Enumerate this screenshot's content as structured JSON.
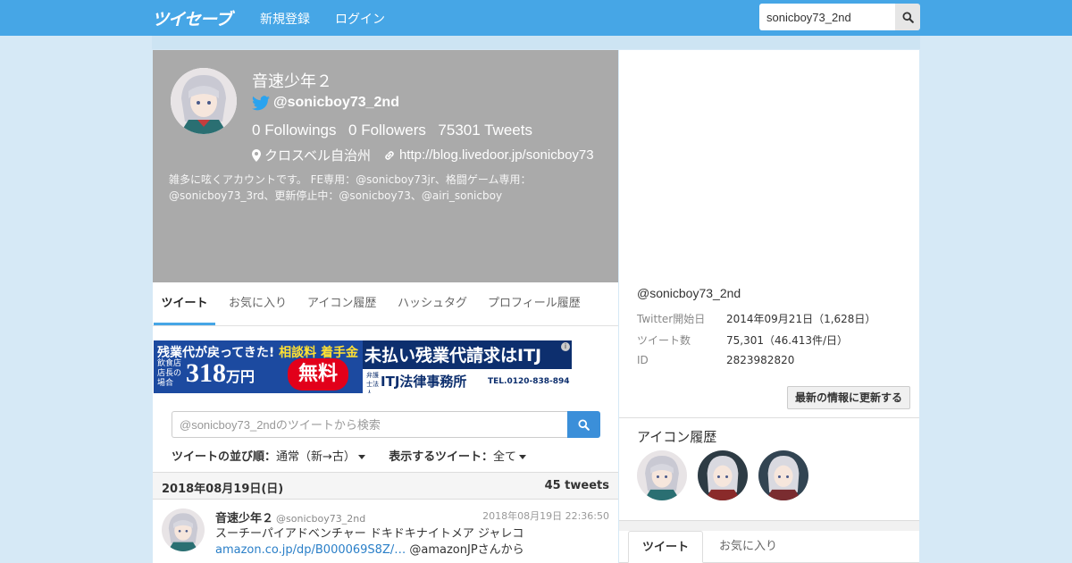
{
  "nav": {
    "logo": "ツイセーブ",
    "signup": "新規登録",
    "login": "ログイン",
    "search_value": "sonicboy73_2nd"
  },
  "profile": {
    "name": "音速少年２",
    "handle": "@sonicboy73_2nd",
    "followings_count": "0",
    "followings_label": "Followings",
    "followers_count": "0",
    "followers_label": "Followers",
    "tweets_count": "75301",
    "tweets_label": "Tweets",
    "location": "クロスベル自治州",
    "url": "http://blog.livedoor.jp/sonicboy73",
    "bio": "雑多に呟くアカウントです。 FE専用：@sonicboy73jr、格闘ゲーム専用：@sonicboy73_3rd、更新停止中：@sonicboy73、@airi_sonicboy"
  },
  "tabs": [
    "ツイート",
    "お気に入り",
    "アイコン履歴",
    "ハッシュタグ",
    "プロフィール履歴"
  ],
  "ad": {
    "left_top_a": "残業代が戻ってきた!",
    "left_top_b": "相談料 着手金",
    "left_small": "飲食店店長の場合",
    "left_amount": "318",
    "left_unit": "万円",
    "left_badge": "無料",
    "right_title": "未払い残業代請求はITJ",
    "right_small": "弁護士法人",
    "right_firm": "ITJ法律事務所",
    "right_tel": "TEL.0120-838-894"
  },
  "tweet_search": {
    "placeholder": "@sonicboy73_2ndのツイートから検索"
  },
  "sort": {
    "order_label": "ツイートの並び順：",
    "order_value": "通常（新→古）",
    "filter_label": "表示するツイート：",
    "filter_value": "全て"
  },
  "date_group": {
    "date": "2018年08月19日(日)",
    "count": "45 tweets"
  },
  "tweet": {
    "name": "音速少年２",
    "handle": "@sonicboy73_2nd",
    "time": "2018年08月19日 22:36:50",
    "text_before": "スーチーパイアドベンチャー ドキドキナイトメア ジャレコ ",
    "link": "amazon.co.jp/dp/B000069S8Z/…",
    "text_after": " @amazonJPさんから"
  },
  "side": {
    "handle": "@sonicboy73_2nd",
    "rows": [
      {
        "key": "Twitter開始日",
        "value": "2014年09月21日（1,628日）"
      },
      {
        "key": "ツイート数",
        "value": "75,301（46.413件/日）"
      },
      {
        "key": "ID",
        "value": "2823982820"
      }
    ],
    "update_button": "最新の情報に更新する",
    "icon_history_title": "アイコン履歴",
    "tabs": [
      "ツイート",
      "お気に入り"
    ]
  },
  "colors": {
    "nav_bg": "#46a6e6",
    "accent": "#46a6e6",
    "link": "#2a7fc8",
    "hero_bg": "#aaaaaa"
  }
}
